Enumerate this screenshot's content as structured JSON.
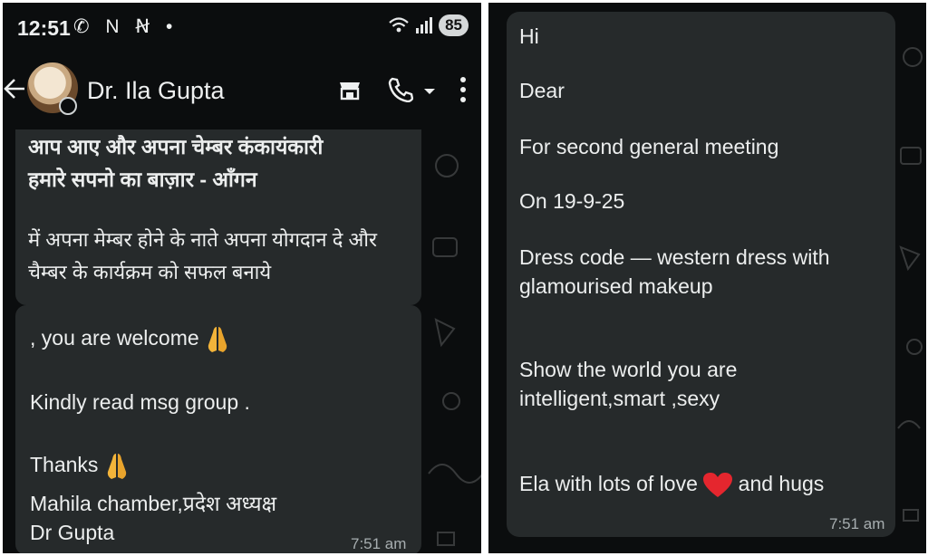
{
  "status_bar": {
    "time": "12:51",
    "notif_icons": "✆ N Ꞥ •",
    "battery": "85"
  },
  "header": {
    "contact_name": "Dr. Ila Gupta"
  },
  "left_messages": {
    "hindi_line1": "आप आए और अपना चेम्बर कंकायंकारी",
    "hindi_line2": "हमारे सपनो का बाज़ार - आँगन",
    "hindi_line3": "में अपना मेम्बर होने के नाते अपना योगदान दे और",
    "hindi_line4": "चैम्बर के कार्यक्रम को सफल बनाये",
    "welcome": ", you are welcome",
    "kindly": "Kindly read msg group .",
    "thanks": "Thanks",
    "signature1": "Mahila chamber,प्रदेश अध्यक्ष",
    "signature2": "Dr Gupta",
    "time": "7:51 am"
  },
  "right_message": {
    "hi": "Hi",
    "dear": "Dear",
    "meeting": "For second general meeting",
    "date": "On 19-9-25",
    "dress1": "Dress code — western dress with",
    "dress2": "glamourised makeup",
    "show1": "Show the world you are",
    "show2": "intelligent,smart ,sexy",
    "love_before": "Ela with lots of love",
    "love_after": "and hugs",
    "time": "7:51 am"
  },
  "colors": {
    "background": "#0b0d0e",
    "bubble": "#262a2b",
    "text": "#eceeee",
    "timestamp": "#a7aeb0"
  },
  "icons": [
    "arrow-back-icon",
    "store-icon",
    "phone-call-icon",
    "dropdown-icon",
    "more-vert-icon",
    "folded-hands-emoji",
    "red-heart-emoji",
    "wifi-icon",
    "signal-icon",
    "whatsapp-icon"
  ]
}
